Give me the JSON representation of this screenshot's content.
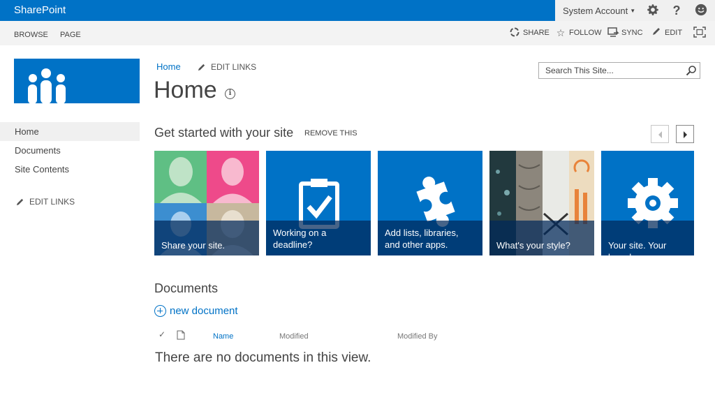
{
  "suite": {
    "brand": "SharePoint",
    "account": "System Account",
    "icons": [
      "gear-icon",
      "help-icon",
      "smiley-icon"
    ]
  },
  "ribbon": {
    "tabs": [
      "BROWSE",
      "PAGE"
    ],
    "actions": [
      {
        "label": "SHARE",
        "icon": "share-icon"
      },
      {
        "label": "FOLLOW",
        "icon": "star-icon"
      },
      {
        "label": "SYNC",
        "icon": "sync-icon"
      },
      {
        "label": "EDIT",
        "icon": "pencil-icon"
      },
      {
        "label": "",
        "icon": "focus-icon"
      }
    ]
  },
  "nav": {
    "items": [
      {
        "label": "Home",
        "active": true
      },
      {
        "label": "Documents",
        "active": false
      },
      {
        "label": "Site Contents",
        "active": false
      }
    ],
    "edit_links": "EDIT LINKS"
  },
  "breadcrumb": {
    "home": "Home",
    "edit_links": "EDIT LINKS"
  },
  "page": {
    "title": "Home"
  },
  "search": {
    "placeholder": "Search This Site..."
  },
  "get_started": {
    "title": "Get started with your site",
    "remove": "REMOVE THIS",
    "tiles": [
      {
        "caption": "Share your site."
      },
      {
        "caption": "Working on a deadline?"
      },
      {
        "caption": "Add lists, libraries, and other apps."
      },
      {
        "caption": "What's your style?"
      },
      {
        "caption": "Your site. Your brand."
      }
    ]
  },
  "documents": {
    "title": "Documents",
    "new": "new document",
    "columns": [
      "Name",
      "Modified",
      "Modified By"
    ],
    "empty": "There are no documents in this view."
  },
  "colors": {
    "accent": "#0072c6",
    "tile_caption_bg": "#00285a"
  }
}
